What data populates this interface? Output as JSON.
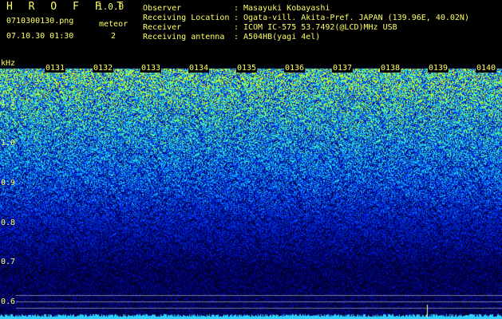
{
  "header": {
    "app_title": "H R O F F T",
    "app_version": "1.0.0",
    "filename": "0710300130.png",
    "datetime": "07.10.30 01:30",
    "meteor_label": "meteor",
    "meteor_count": "2"
  },
  "info": [
    {
      "key": "Observer",
      "sep": ":",
      "value": "Masayuki Kobayashi"
    },
    {
      "key": "Receiving Location",
      "sep": ":",
      "value": "Ogata-vill. Akita-Pref. JAPAN (139.96E, 40.02N)"
    },
    {
      "key": "Receiver",
      "sep": ":",
      "value": "ICOM IC-575 53.7492(@LCD)MHz USB"
    },
    {
      "key": "Receiving antenna",
      "sep": ":",
      "value": "A504HB(yagi 4el)"
    }
  ],
  "axes": {
    "y_unit": "kHz",
    "y_ticks": [
      "1.1",
      "1.0",
      "0.9",
      "0.8",
      "0.7",
      "0.6"
    ],
    "x_ticks": [
      "0131",
      "0132",
      "0133",
      "0134",
      "0135",
      "0136",
      "0137",
      "0138",
      "0139",
      "0140"
    ]
  },
  "colors": {
    "label": "#ffff66",
    "background": "#000000",
    "noise_high": "#40ffb0",
    "noise_mid": "#2050ff",
    "noise_low": "#0a0a60"
  }
}
